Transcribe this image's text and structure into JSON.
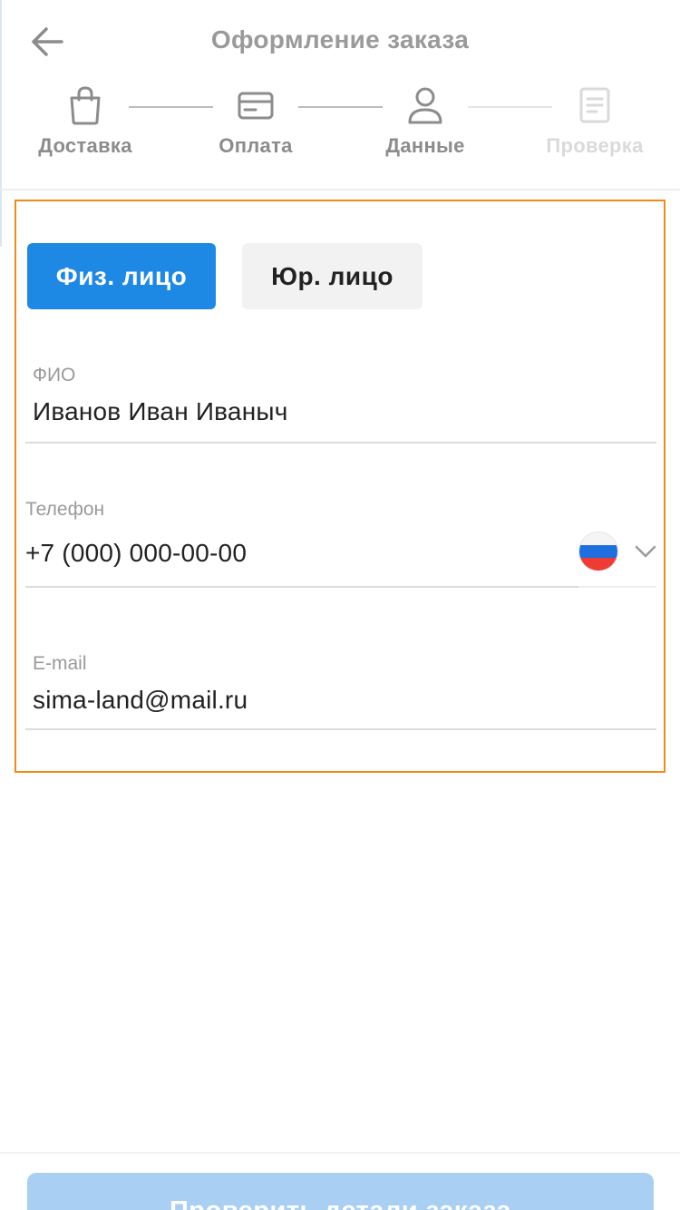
{
  "header": {
    "title": "Оформление заказа",
    "back_icon": "arrow-left-icon"
  },
  "stepper": {
    "steps": [
      {
        "label": "Доставка",
        "icon": "shopping-bag-icon",
        "state": "done"
      },
      {
        "label": "Оплата",
        "icon": "credit-card-icon",
        "state": "done"
      },
      {
        "label": "Данные",
        "icon": "user-icon",
        "state": "current"
      },
      {
        "label": "Проверка",
        "icon": "document-icon",
        "state": "inactive"
      }
    ]
  },
  "customer_type": {
    "individual_label": "Физ. лицо",
    "legal_label": "Юр. лицо",
    "selected": "individual"
  },
  "form": {
    "name": {
      "label": "ФИО",
      "value": "Иванов Иван Иваныч"
    },
    "phone": {
      "label": "Телефон",
      "value": "+7 (000) 000-00-00",
      "country_flag": "russia-flag-icon"
    },
    "email": {
      "label": "E-mail",
      "value": "sima-land@mail.ru"
    }
  },
  "footer": {
    "submit_label": "Проверить детали заказа"
  },
  "colors": {
    "accent": "#1e88e5",
    "highlight_border": "#f08a1a",
    "submit_disabled": "#a9d0f2"
  }
}
